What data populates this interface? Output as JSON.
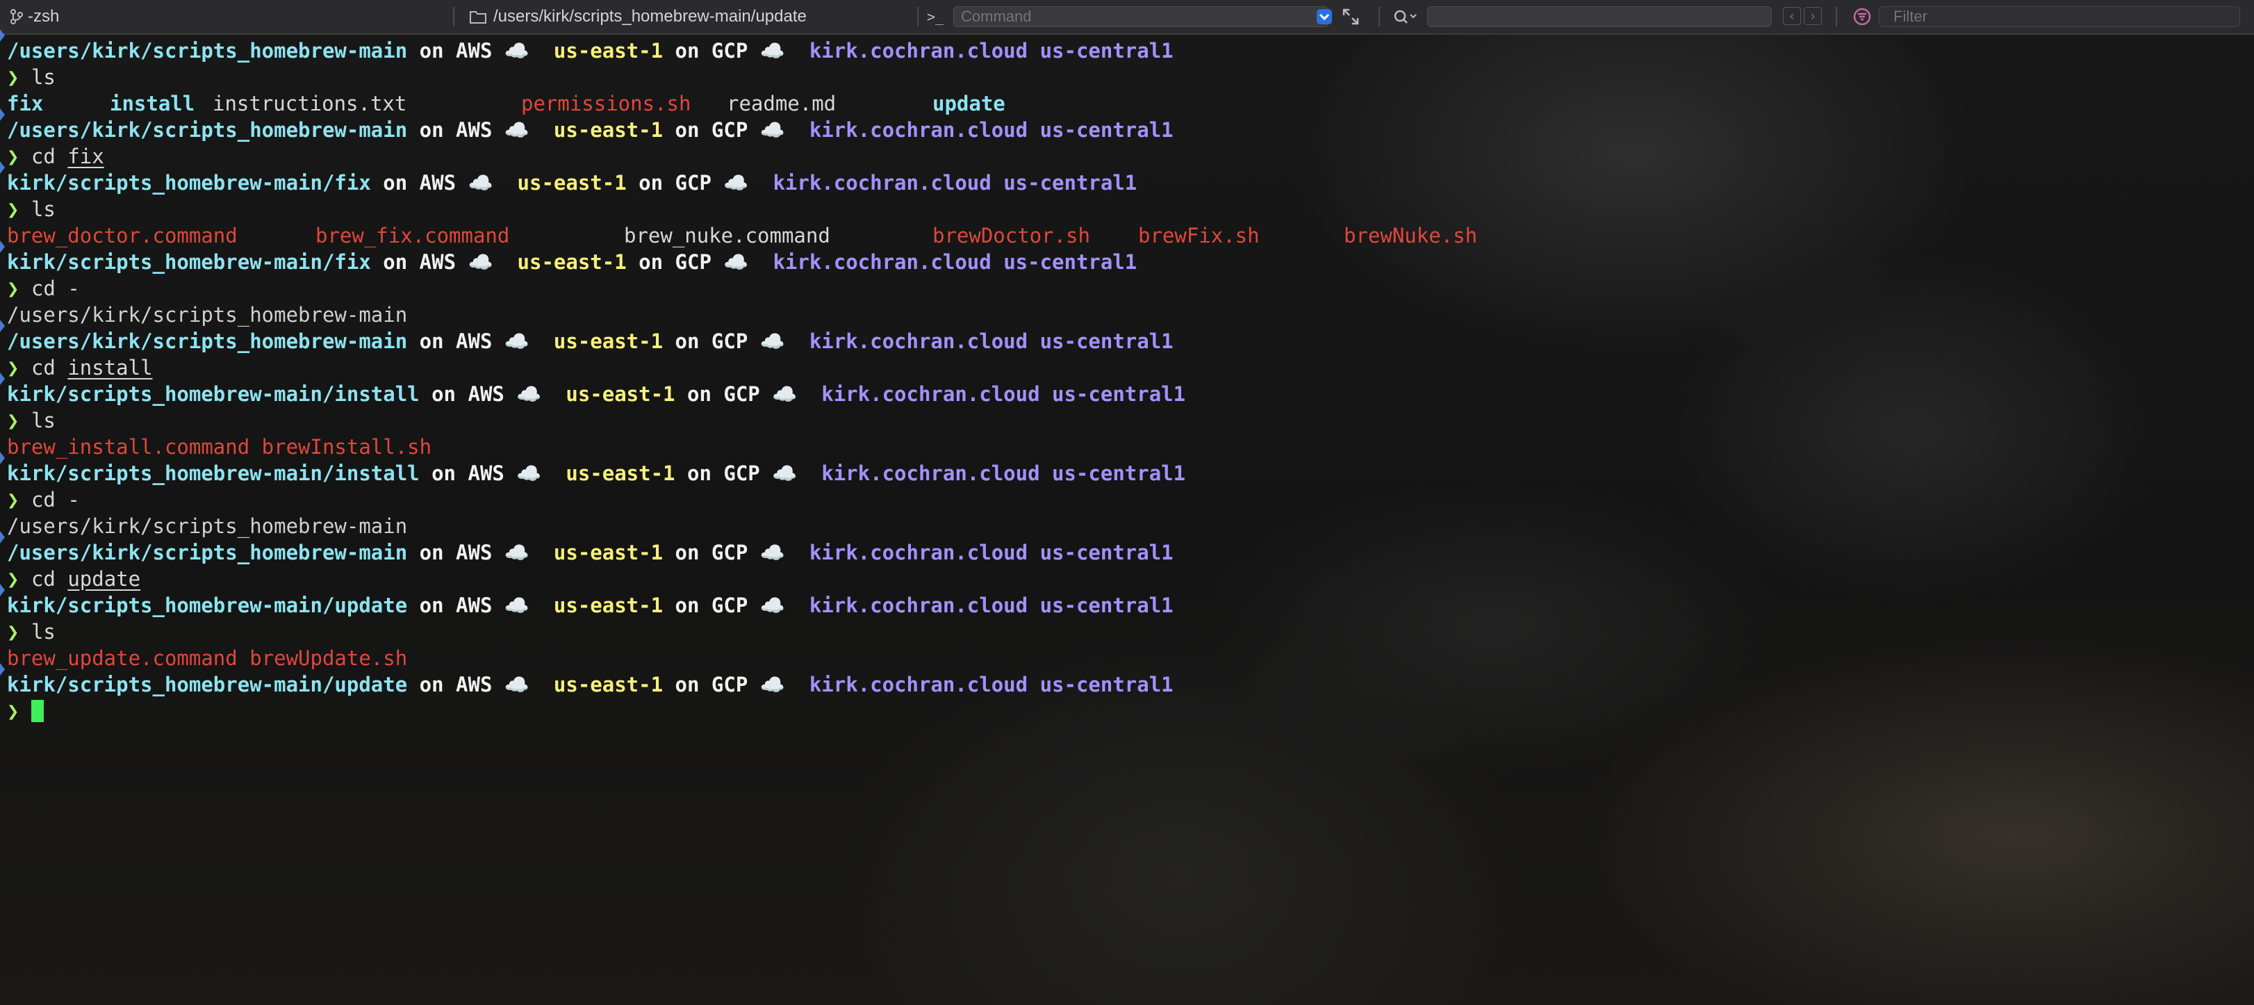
{
  "titlebar": {
    "tab_label": "-zsh",
    "path_label": "/users/kirk/scripts_homebrew-main/update",
    "command_prompt_glyph": ">_",
    "command_placeholder": "Command",
    "filter_placeholder": "Filter",
    "icons": [
      "branch-icon",
      "folder-icon",
      "terminal-icon",
      "dropdown-icon",
      "expand-icon",
      "search-icon",
      "prev-icon",
      "next-icon",
      "filter-icon"
    ]
  },
  "colors": {
    "path": "#8de3f0",
    "region": "#f6f07a",
    "project": "#a391ff",
    "prompt": "#a8f36a",
    "executable": "#e0473c",
    "cursor": "#3ff05a"
  },
  "prompt_symbol": "❯",
  "segments": {
    "on": "on",
    "aws": "AWS",
    "gcp": "GCP",
    "cloud": "☁️",
    "region": "us-east-1",
    "gcp_project": "kirk.cochran.cloud",
    "gcp_region": "us-central1"
  },
  "blocks": [
    {
      "cwd": "/users/kirk/scripts_homebrew-main",
      "command": "ls",
      "arg": "",
      "output_type": "ls",
      "output": [
        {
          "name": "fix",
          "kind": "dir"
        },
        {
          "name": "install",
          "kind": "dir"
        },
        {
          "name": "instructions.txt",
          "kind": "file"
        },
        {
          "name": "permissions.sh",
          "kind": "exe"
        },
        {
          "name": "readme.md",
          "kind": "file"
        },
        {
          "name": "update",
          "kind": "dir"
        }
      ]
    },
    {
      "cwd": "/users/kirk/scripts_homebrew-main",
      "command": "cd",
      "arg": "fix",
      "output_type": "none",
      "output": []
    },
    {
      "cwd": "kirk/scripts_homebrew-main/fix",
      "command": "ls",
      "arg": "",
      "output_type": "ls",
      "output": [
        {
          "name": "brew_doctor.command",
          "kind": "exe"
        },
        {
          "name": "brew_fix.command",
          "kind": "exe"
        },
        {
          "name": "brew_nuke.command",
          "kind": "file"
        },
        {
          "name": "brewDoctor.sh",
          "kind": "exe"
        },
        {
          "name": "brewFix.sh",
          "kind": "exe"
        },
        {
          "name": "brewNuke.sh",
          "kind": "exe"
        }
      ]
    },
    {
      "cwd": "kirk/scripts_homebrew-main/fix",
      "command": "cd -",
      "arg": "",
      "output_type": "text",
      "output": [
        "/users/kirk/scripts_homebrew-main"
      ]
    },
    {
      "cwd": "/users/kirk/scripts_homebrew-main",
      "command": "cd",
      "arg": "install",
      "output_type": "none",
      "output": []
    },
    {
      "cwd": "kirk/scripts_homebrew-main/install",
      "command": "ls",
      "arg": "",
      "output_type": "ls",
      "output": [
        {
          "name": "brew_install.command",
          "kind": "exe"
        },
        {
          "name": "brewInstall.sh",
          "kind": "exe"
        }
      ]
    },
    {
      "cwd": "kirk/scripts_homebrew-main/install",
      "command": "cd -",
      "arg": "",
      "output_type": "text",
      "output": [
        "/users/kirk/scripts_homebrew-main"
      ]
    },
    {
      "cwd": "/users/kirk/scripts_homebrew-main",
      "command": "cd",
      "arg": "update",
      "output_type": "none",
      "output": []
    },
    {
      "cwd": "kirk/scripts_homebrew-main/update",
      "command": "ls",
      "arg": "",
      "output_type": "ls",
      "output": [
        {
          "name": "brew_update.command",
          "kind": "exe"
        },
        {
          "name": "brewUpdate.sh",
          "kind": "exe"
        }
      ]
    },
    {
      "cwd": "kirk/scripts_homebrew-main/update",
      "command": "",
      "arg": "",
      "output_type": "cursor",
      "output": []
    }
  ]
}
